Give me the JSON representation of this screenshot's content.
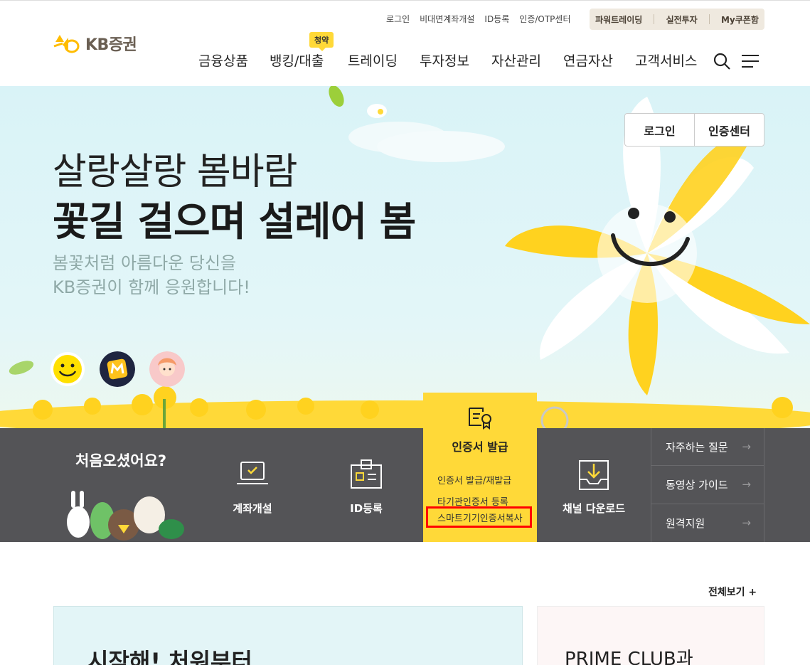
{
  "header": {
    "logo_text": "KB증권",
    "utility_links": [
      "로그인",
      "비대면계좌개설",
      "ID등록",
      "인증/OTP센터"
    ],
    "utility_box": [
      "파워트레이딩",
      "실전투자",
      "My쿠폰함"
    ],
    "gnb": [
      "금융상품",
      "뱅킹/대출",
      "트레이딩",
      "투자정보",
      "자산관리",
      "연금자산",
      "고객서비스"
    ],
    "gnb_badge": "청약"
  },
  "hero": {
    "title_line1": "살랑살랑 봄바람",
    "title_line2": "꽃길 걸으며 설레어 봄",
    "sub_line1": "봄꽃처럼 아름다운 당신을",
    "sub_line2": "KB증권이 함께 응원합니다!",
    "login_button": "로그인",
    "cert_center_button": "인증센터"
  },
  "quick": {
    "welcome": "처음오셨어요?",
    "account_open": "계좌개설",
    "id_register": "ID등록",
    "cert_title": "인증서 발급",
    "cert_links": [
      "인증서 발급/재발급",
      "타기관인증서 등록",
      "스마트기기인증서복사"
    ],
    "channel_download": "채널 다운로드",
    "side_links": [
      "자주하는 질문",
      "동영상 가이드",
      "원격지원"
    ]
  },
  "content": {
    "view_all": "전체보기 +",
    "card1_title": "시작해! 처워부터",
    "card2_title": "PRIME CLUB과"
  },
  "colors": {
    "brand_yellow": "#ffd938",
    "quickbar_gray": "#545457",
    "highlight_red": "#ff0000"
  }
}
